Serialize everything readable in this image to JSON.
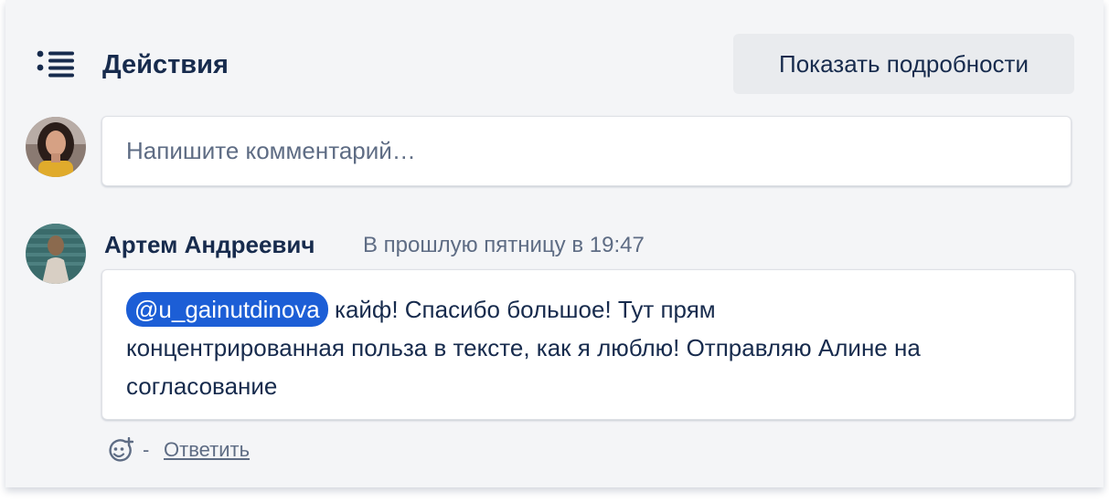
{
  "activity": {
    "title": "Действия",
    "icon": "list-icon",
    "details_button": "Показать подробности"
  },
  "comment_form": {
    "placeholder": "Напишите комментарий…"
  },
  "comment": {
    "author": "Артем Андреевич",
    "timestamp": "В прошлую пятницу в 19:47",
    "mention": "@u_gainutdinova",
    "text_line1": " кайф! Спасибо большое! Тут прям",
    "text_line2": "концентрированная польза в тексте, как я люблю! Отправляю Алине на",
    "text_line3": "согласование",
    "separator": "-",
    "reply_label": "Ответить",
    "reaction_icon": "add-reaction-icon"
  },
  "colors": {
    "panel_bg": "#f4f5f7",
    "text_primary": "#172b4d",
    "text_secondary": "#5e6c84",
    "mention_bg": "#1c5ed6",
    "button_bg": "#e9ebee"
  }
}
